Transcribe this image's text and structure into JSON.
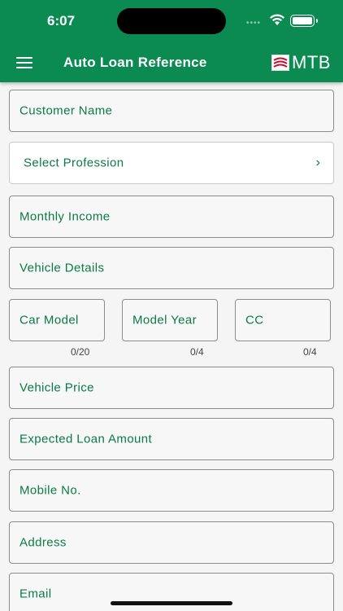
{
  "status": {
    "time": "6:07"
  },
  "header": {
    "title": "Auto Loan Reference",
    "brand": "MTB"
  },
  "form": {
    "customer_name": "Customer Name",
    "profession": "Select Profession",
    "monthly_income": "Monthly Income",
    "vehicle_details": "Vehicle Details",
    "car_model": {
      "label": "Car Model",
      "counter": "0/20"
    },
    "model_year": {
      "label": "Model Year",
      "counter": "0/4"
    },
    "cc": {
      "label": "CC",
      "counter": "0/4"
    },
    "vehicle_price": "Vehicle Price",
    "expected_loan": "Expected Loan Amount",
    "mobile": "Mobile No.",
    "address": "Address",
    "email": "Email"
  },
  "colors": {
    "header": "#0b8a52",
    "accent": "#0b7a48"
  },
  "icons": {
    "menu": "hamburger-icon",
    "chevron": "chevron-right-icon",
    "wifi": "wifi-icon",
    "battery": "battery-icon"
  }
}
